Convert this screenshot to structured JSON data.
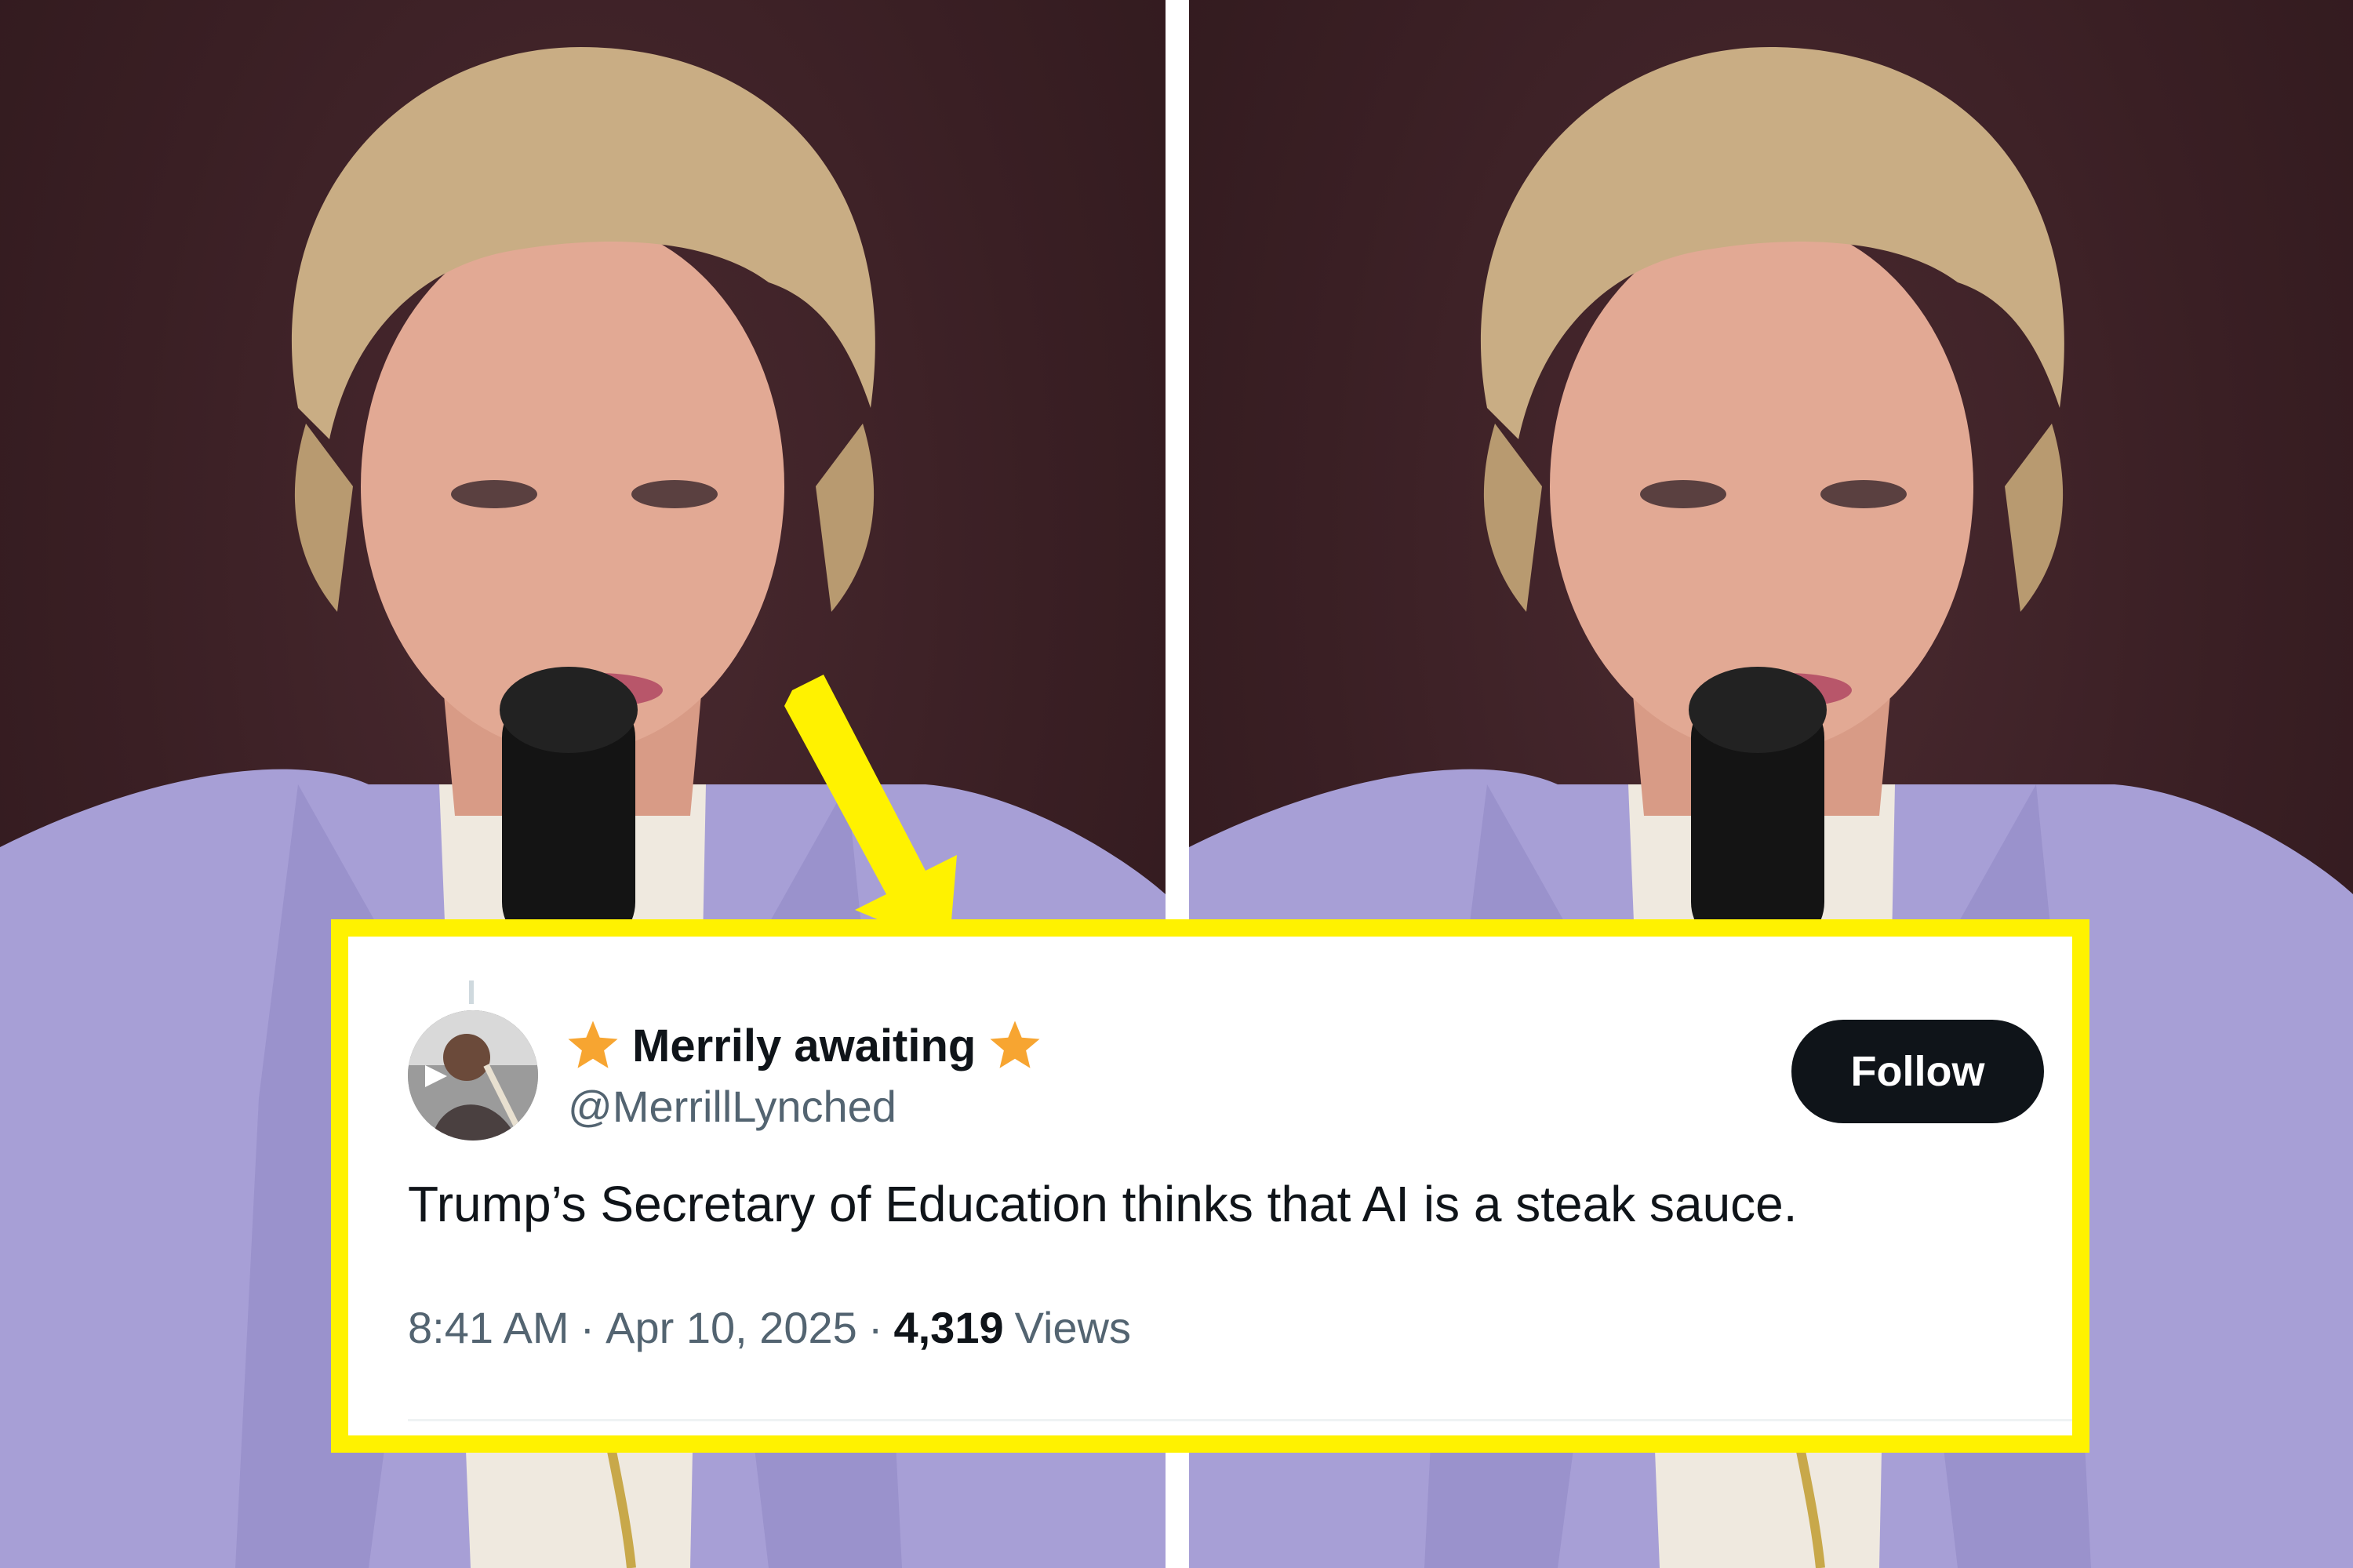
{
  "tweet": {
    "display_name": "Merrily awaiting",
    "handle": "@MerrillLynched",
    "follow_label": "Follow",
    "text": "Trump’s Secretary of Education thinks that AI is a steak sauce.",
    "time": "8:41 AM",
    "separator": "·",
    "date": "Apr 10, 2025",
    "views_count": "4,319",
    "views_label": "Views"
  },
  "colors": {
    "highlight_frame": "#fff200",
    "arrow": "#fff200",
    "star": "#f7a531",
    "follow_button": "#0f1419",
    "secondary_text": "#536471",
    "backdrop": "#3a1f24",
    "jacket": "#a79fd6"
  },
  "icons": {
    "name_prefix": "star-icon",
    "name_suffix": "star-icon",
    "pointer": "arrow-icon"
  }
}
